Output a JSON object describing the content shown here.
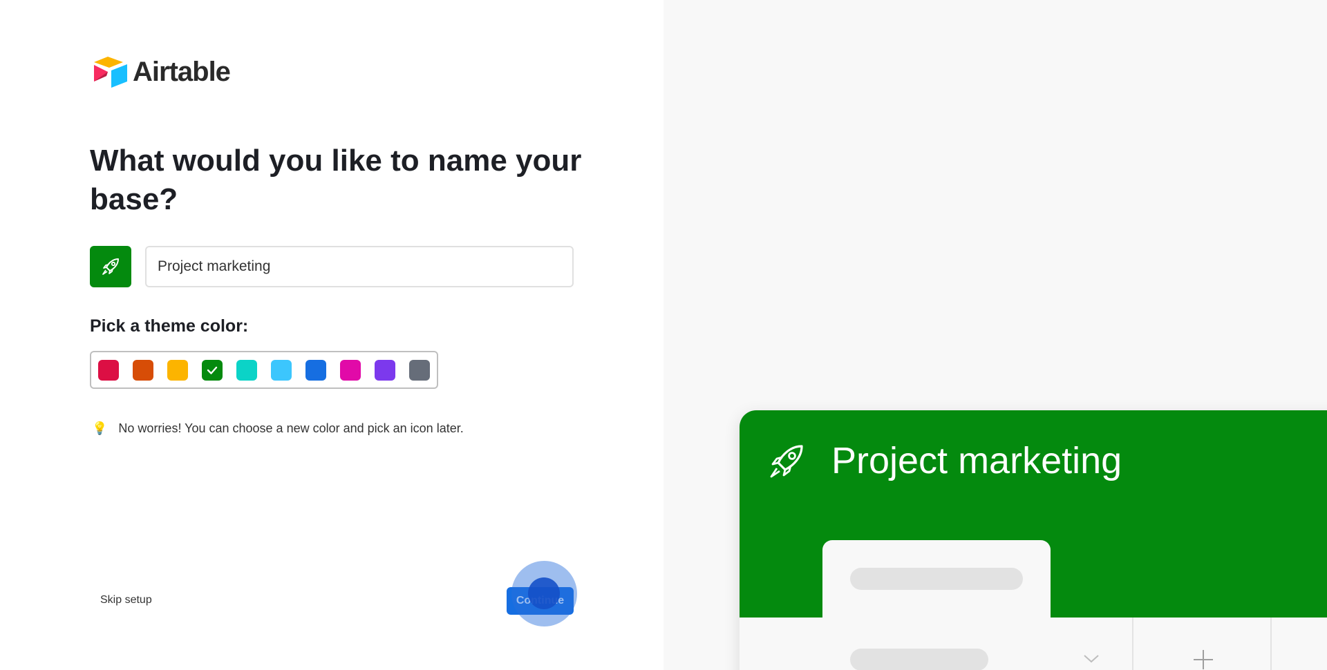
{
  "logo": {
    "text": "Airtable"
  },
  "heading": "What would you like to name your base?",
  "name_input": {
    "value": "Project marketing"
  },
  "theme": {
    "label": "Pick a theme color:",
    "selected_index": 3,
    "colors": [
      "#dc0f44",
      "#d74d07",
      "#fcb400",
      "#048a0e",
      "#0bd3c7",
      "#3cc6fd",
      "#166ee1",
      "#e10aa8",
      "#7c39ed",
      "#666d79"
    ]
  },
  "tip": {
    "icon": "lightbulb-icon",
    "text": "No worries! You can choose a new color and pick an icon later."
  },
  "footer": {
    "skip_label": "Skip setup",
    "continue_label": "Continue"
  },
  "preview": {
    "title": "Project marketing",
    "accent": "#048a0e"
  }
}
